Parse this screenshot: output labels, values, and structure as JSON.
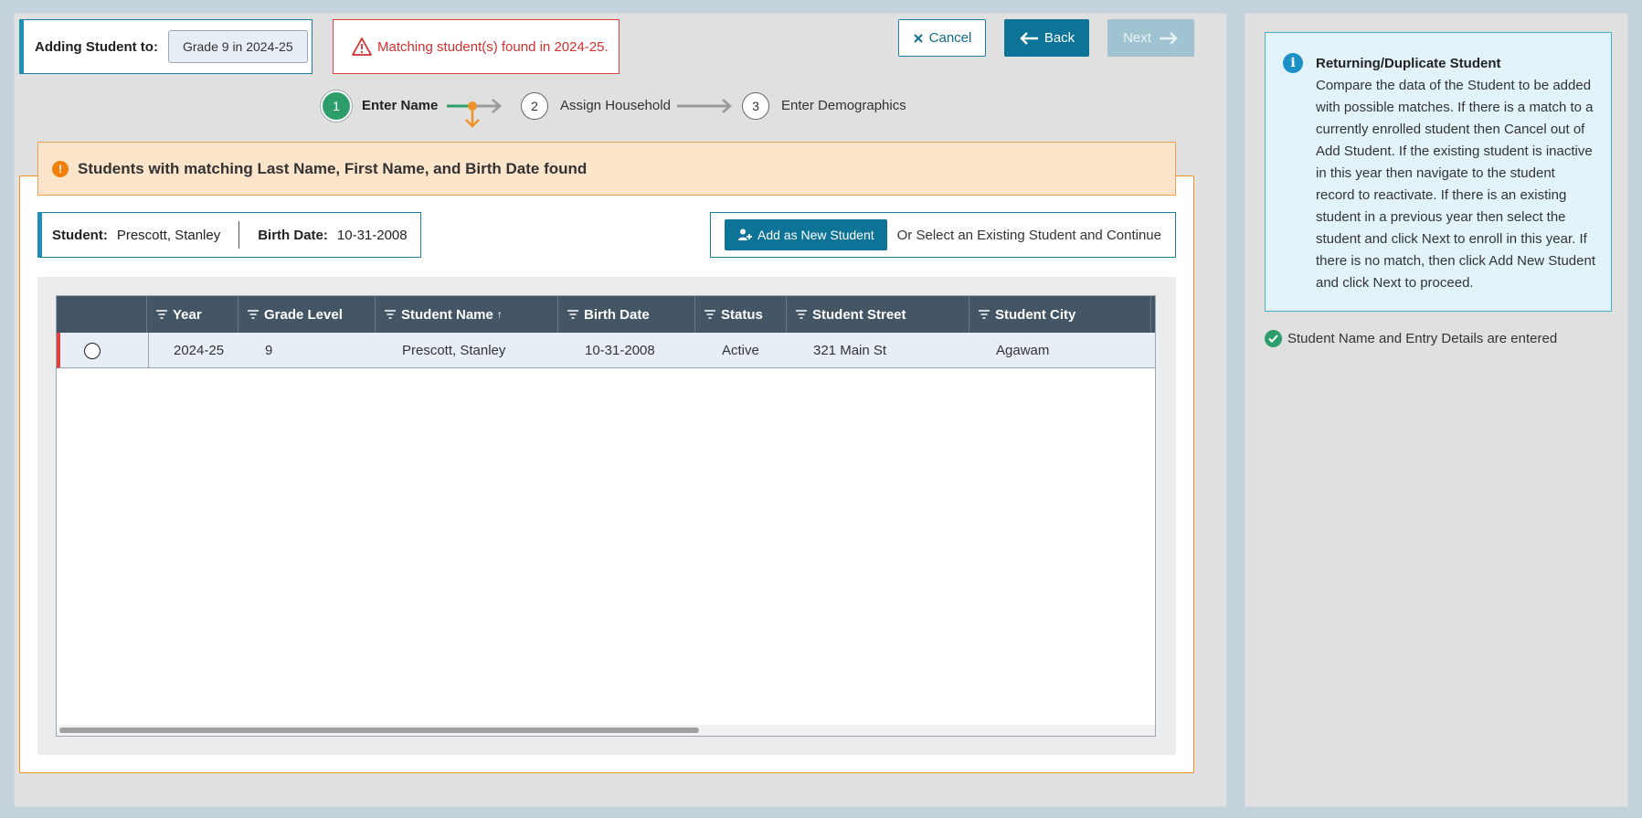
{
  "header": {
    "adding_label": "Adding Student to:",
    "grade_chip": "Grade 9 in 2024-25",
    "match_alert": "Matching student(s) found in 2024-25."
  },
  "buttons": {
    "cancel": "Cancel",
    "back": "Back",
    "next": "Next"
  },
  "stepper": {
    "steps": [
      {
        "number": "1",
        "label": "Enter Name"
      },
      {
        "number": "2",
        "label": "Assign Household"
      },
      {
        "number": "3",
        "label": "Enter Demographics"
      }
    ]
  },
  "banner": {
    "icon": "!",
    "text": "Students with matching Last Name, First Name, and Birth Date found"
  },
  "student_summary": {
    "student_label": "Student:",
    "student_value": "Prescott, Stanley",
    "birth_label": "Birth Date:",
    "birth_value": "10-31-2008"
  },
  "actions": {
    "add_new": "Add as New Student",
    "or_select": "Or Select an Existing Student and Continue"
  },
  "grid": {
    "columns": [
      "Year",
      "Grade Level",
      "Student Name",
      "Birth Date",
      "Status",
      "Student Street",
      "Student City"
    ],
    "sort_indicator": "↑",
    "rows": [
      {
        "year": "2024-25",
        "grade": "9",
        "name": "Prescott, Stanley",
        "birth": "10-31-2008",
        "status": "Active",
        "street": "321 Main St",
        "city": "Agawam"
      }
    ]
  },
  "info": {
    "icon": "i",
    "title": "Returning/Duplicate Student",
    "text": "Compare the data of the Student to be added with possible matches. If there is a match to a currently enrolled student then Cancel out of Add Student. If the existing student is inactive in this year then navigate to the student record to reactivate. If there is an existing student in a previous year then select the student and click Next to enroll in this year. If there is no match, then click Add New Student and click Next to proceed."
  },
  "checklist": {
    "item": "Student Name and Entry Details are entered"
  },
  "colors": {
    "primary": "#0d7397",
    "warning": "#f0922a",
    "error": "#d32f2f",
    "success": "#2e9d6c",
    "grid_header": "#445566"
  }
}
